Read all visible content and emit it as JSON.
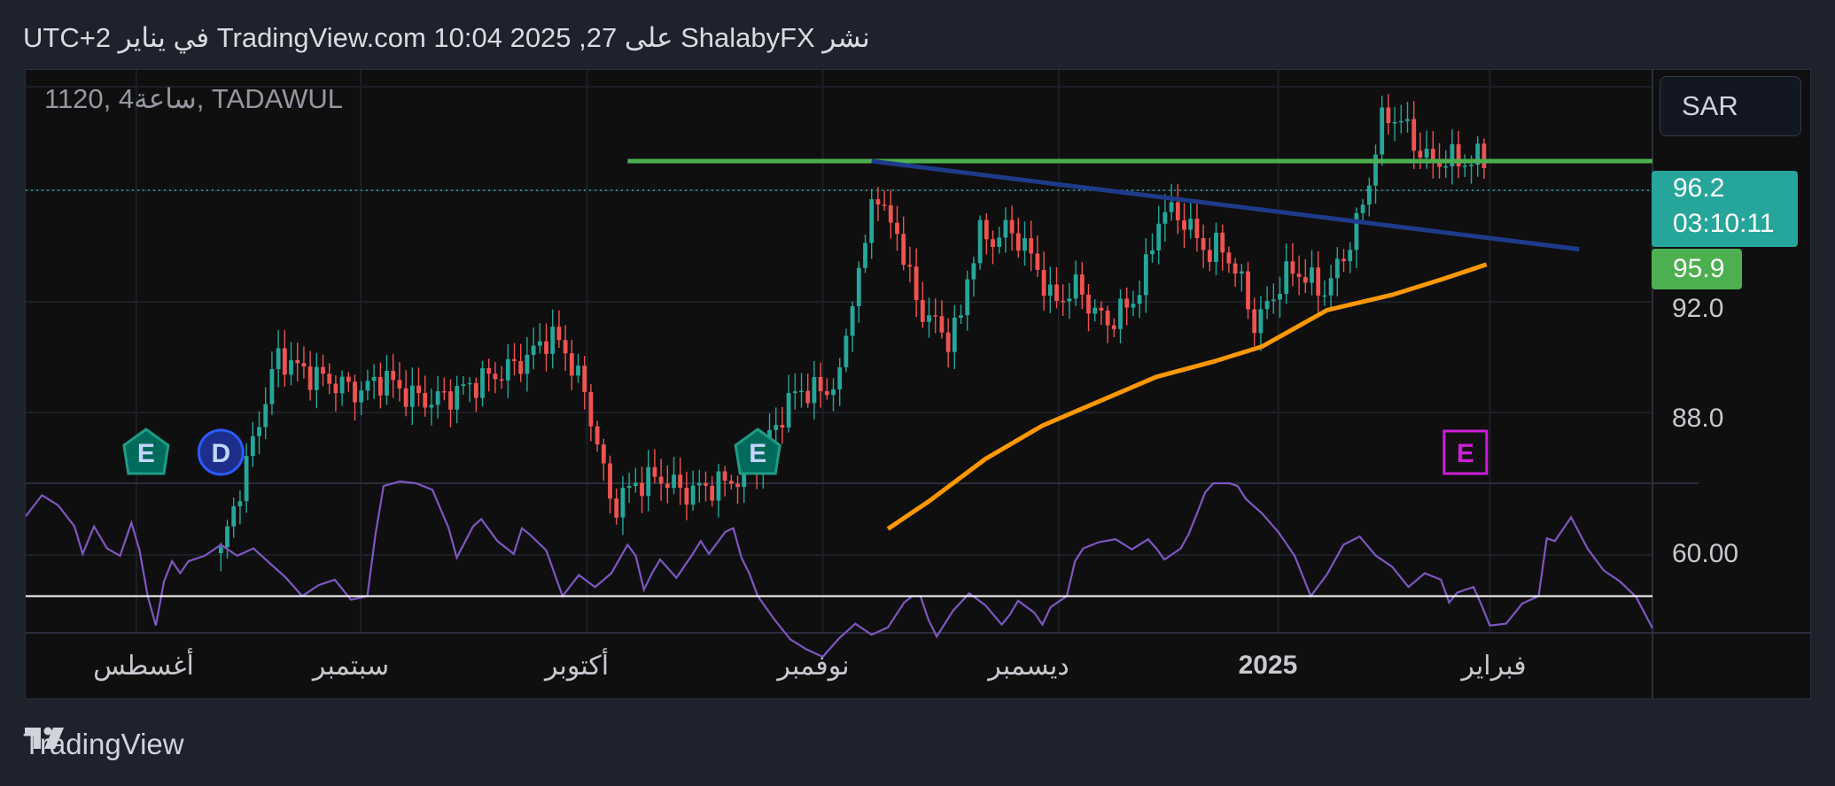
{
  "header": {
    "published": "نشر ShalabyFX على TradingView.com 10:04 2025 ,27 في يناير UTC+2"
  },
  "symbol": {
    "label": "1120, 4ساعة, TADAWUL"
  },
  "currency": "SAR",
  "price_tag": {
    "price": "96.2",
    "countdown": "03:10:11"
  },
  "green_tag": "95.9",
  "price_axis": {
    "labels": [
      "92.0",
      "88.0"
    ]
  },
  "rsi_axis": {
    "labels": [
      "60.00"
    ]
  },
  "time_axis": {
    "labels": [
      "أغسطس",
      "سبتمبر",
      "أكتوبر",
      "نوفمبر",
      "ديسمبر",
      "2025",
      "فبراير"
    ]
  },
  "event_markers": [
    {
      "letter": "E",
      "kind": "earnings"
    },
    {
      "letter": "D",
      "kind": "dividend"
    },
    {
      "letter": "E",
      "kind": "earnings"
    },
    {
      "letter": "E",
      "kind": "earnings-upcoming"
    }
  ],
  "footer": {
    "brand": "TradingView"
  },
  "colors": {
    "up": "#26a69a",
    "down": "#ef5350",
    "resistance": "#4caf50",
    "trendline": "#1e3a8a",
    "moving_average": "#ff9800",
    "rsi": "#7e57c2",
    "rsi_level": "#ffffff",
    "background": "#0f0f0f",
    "frame": "#1e222d"
  },
  "chart_data": [
    {
      "type": "candlestick",
      "title": "1120, 4ساعة, TADAWUL",
      "currency": "SAR",
      "x": [
        "أغسطس",
        "سبتمبر",
        "أكتوبر",
        "نوفمبر",
        "ديسمبر",
        "2025",
        "فبراير"
      ],
      "ylim": [
        85.3,
        98.9
      ],
      "y_ticks": [
        92.0,
        88.0
      ],
      "last_price": 96.2,
      "resistance_level": 95.9,
      "series": [
        {
          "name": "price_close",
          "points": [
            [
              0.12,
              83.0
            ],
            [
              0.155,
              89.5
            ],
            [
              0.17,
              89.0
            ],
            [
              0.19,
              88.6
            ],
            [
              0.205,
              88.3
            ],
            [
              0.22,
              88.8
            ],
            [
              0.235,
              88.2
            ],
            [
              0.25,
              88.0
            ],
            [
              0.265,
              88.3
            ],
            [
              0.28,
              88.7
            ],
            [
              0.295,
              89.0
            ],
            [
              0.31,
              89.5
            ],
            [
              0.322,
              90.2
            ],
            [
              0.33,
              89.8
            ],
            [
              0.338,
              89.0
            ],
            [
              0.345,
              88.0
            ],
            [
              0.352,
              86.5
            ],
            [
              0.36,
              84.5
            ],
            [
              0.375,
              85.3
            ],
            [
              0.39,
              85.5
            ],
            [
              0.405,
              85.0
            ],
            [
              0.42,
              85.2
            ],
            [
              0.435,
              85.4
            ],
            [
              0.45,
              86.0
            ],
            [
              0.465,
              87.6
            ],
            [
              0.475,
              88.4
            ],
            [
              0.487,
              88.3
            ],
            [
              0.5,
              88.6
            ],
            [
              0.508,
              91.5
            ],
            [
              0.515,
              92.6
            ],
            [
              0.522,
              95.5
            ],
            [
              0.527,
              94.0
            ],
            [
              0.535,
              93.8
            ],
            [
              0.542,
              92.2
            ],
            [
              0.55,
              91.0
            ],
            [
              0.56,
              90.5
            ],
            [
              0.568,
              90.0
            ],
            [
              0.575,
              90.8
            ],
            [
              0.58,
              92.5
            ],
            [
              0.587,
              93.5
            ],
            [
              0.595,
              93.3
            ],
            [
              0.605,
              93.7
            ],
            [
              0.615,
              93.0
            ],
            [
              0.622,
              92.4
            ],
            [
              0.63,
              91.3
            ],
            [
              0.64,
              91.5
            ],
            [
              0.648,
              91.8
            ],
            [
              0.655,
              91.0
            ],
            [
              0.665,
              90.6
            ],
            [
              0.675,
              91.0
            ],
            [
              0.682,
              91.4
            ],
            [
              0.69,
              92.5
            ],
            [
              0.697,
              94.2
            ],
            [
              0.705,
              94.2
            ],
            [
              0.712,
              94.0
            ],
            [
              0.72,
              93.3
            ],
            [
              0.728,
              92.9
            ],
            [
              0.735,
              93.1
            ],
            [
              0.742,
              92.5
            ],
            [
              0.75,
              91.5
            ],
            [
              0.755,
              90.5
            ],
            [
              0.762,
              91.0
            ],
            [
              0.77,
              91.8
            ],
            [
              0.778,
              92.3
            ],
            [
              0.785,
              92.2
            ],
            [
              0.79,
              91.9
            ],
            [
              0.797,
              91.6
            ],
            [
              0.803,
              92.0
            ],
            [
              0.81,
              92.8
            ],
            [
              0.817,
              93.6
            ],
            [
              0.825,
              95.0
            ],
            [
              0.832,
              97.0
            ],
            [
              0.838,
              97.4
            ],
            [
              0.845,
              97.3
            ],
            [
              0.852,
              96.6
            ],
            [
              0.858,
              96.2
            ],
            [
              0.865,
              95.8
            ],
            [
              0.872,
              96.0
            ],
            [
              0.88,
              95.9
            ],
            [
              0.888,
              95.9
            ],
            [
              0.895,
              96.0
            ],
            [
              0.9,
              95.9
            ]
          ]
        },
        {
          "name": "resistance",
          "points": [
            [
              0.37,
              95.9
            ],
            [
              1.0,
              95.9
            ]
          ]
        },
        {
          "name": "trendline",
          "points": [
            [
              0.52,
              95.9
            ],
            [
              0.955,
              93.0
            ]
          ]
        },
        {
          "name": "moving_average",
          "points": [
            [
              0.53,
              83.8
            ],
            [
              0.555,
              84.7
            ],
            [
              0.59,
              86.1
            ],
            [
              0.625,
              87.2
            ],
            [
              0.66,
              88.0
            ],
            [
              0.695,
              88.8
            ],
            [
              0.73,
              89.3
            ],
            [
              0.76,
              89.8
            ],
            [
              0.8,
              91.0
            ],
            [
              0.84,
              91.5
            ],
            [
              0.87,
              92.0
            ],
            [
              0.898,
              92.5
            ]
          ]
        }
      ]
    },
    {
      "type": "line",
      "title": "",
      "ylim": [
        50.0,
        66.3
      ],
      "y_ticks": [
        60.0
      ],
      "reference_level": 54.0,
      "series": [
        {
          "name": "",
          "points": [
            [
              0.0,
              62.7
            ],
            [
              0.01,
              65.0
            ],
            [
              0.02,
              63.9
            ],
            [
              0.03,
              61.6
            ],
            [
              0.035,
              58.6
            ],
            [
              0.042,
              61.6
            ],
            [
              0.05,
              59.2
            ],
            [
              0.058,
              58.4
            ],
            [
              0.065,
              62.0
            ],
            [
              0.07,
              59.0
            ],
            [
              0.075,
              54.0
            ],
            [
              0.08,
              50.8
            ],
            [
              0.085,
              55.6
            ],
            [
              0.09,
              57.8
            ],
            [
              0.095,
              56.5
            ],
            [
              0.1,
              57.8
            ],
            [
              0.11,
              58.4
            ],
            [
              0.12,
              59.6
            ],
            [
              0.13,
              58.4
            ],
            [
              0.14,
              59.2
            ],
            [
              0.15,
              57.6
            ],
            [
              0.16,
              56.0
            ],
            [
              0.17,
              54.0
            ],
            [
              0.18,
              55.2
            ],
            [
              0.19,
              55.8
            ],
            [
              0.2,
              53.6
            ],
            [
              0.21,
              54.0
            ],
            [
              0.215,
              60.7
            ],
            [
              0.22,
              66.0
            ],
            [
              0.23,
              66.5
            ],
            [
              0.24,
              66.3
            ],
            [
              0.25,
              65.6
            ],
            [
              0.26,
              61.4
            ],
            [
              0.265,
              58.2
            ],
            [
              0.275,
              61.6
            ],
            [
              0.28,
              62.4
            ],
            [
              0.29,
              60.0
            ],
            [
              0.3,
              58.6
            ],
            [
              0.305,
              61.4
            ],
            [
              0.31,
              60.7
            ],
            [
              0.32,
              59.0
            ],
            [
              0.33,
              54.0
            ],
            [
              0.34,
              56.3
            ],
            [
              0.35,
              55.0
            ],
            [
              0.36,
              56.5
            ],
            [
              0.37,
              59.6
            ],
            [
              0.375,
              58.4
            ],
            [
              0.38,
              54.7
            ],
            [
              0.385,
              56.5
            ],
            [
              0.39,
              58.0
            ],
            [
              0.4,
              56.0
            ],
            [
              0.41,
              58.6
            ],
            [
              0.415,
              60.0
            ],
            [
              0.42,
              58.6
            ],
            [
              0.43,
              61.0
            ],
            [
              0.435,
              61.4
            ],
            [
              0.44,
              58.2
            ],
            [
              0.445,
              56.4
            ],
            [
              0.45,
              54.0
            ],
            [
              0.46,
              51.5
            ],
            [
              0.47,
              49.3
            ],
            [
              0.48,
              48.2
            ],
            [
              0.49,
              47.4
            ],
            [
              0.5,
              49.4
            ],
            [
              0.51,
              51.0
            ],
            [
              0.52,
              49.8
            ],
            [
              0.53,
              50.6
            ],
            [
              0.54,
              53.3
            ],
            [
              0.545,
              54.0
            ],
            [
              0.55,
              54.0
            ],
            [
              0.555,
              51.4
            ],
            [
              0.56,
              49.6
            ],
            [
              0.57,
              52.4
            ],
            [
              0.58,
              54.3
            ],
            [
              0.59,
              53.0
            ],
            [
              0.6,
              50.9
            ],
            [
              0.605,
              52.0
            ],
            [
              0.61,
              53.5
            ],
            [
              0.62,
              52.2
            ],
            [
              0.625,
              50.9
            ],
            [
              0.63,
              52.8
            ],
            [
              0.64,
              54.0
            ],
            [
              0.645,
              57.8
            ],
            [
              0.65,
              59.2
            ],
            [
              0.66,
              59.9
            ],
            [
              0.67,
              60.2
            ],
            [
              0.68,
              59.1
            ],
            [
              0.69,
              60.2
            ],
            [
              0.695,
              59.2
            ],
            [
              0.7,
              58.0
            ],
            [
              0.71,
              59.2
            ],
            [
              0.715,
              60.8
            ],
            [
              0.72,
              63.0
            ],
            [
              0.725,
              65.3
            ],
            [
              0.73,
              66.3
            ],
            [
              0.74,
              66.3
            ],
            [
              0.745,
              66.0
            ],
            [
              0.75,
              64.6
            ],
            [
              0.76,
              63.0
            ],
            [
              0.77,
              61.0
            ],
            [
              0.78,
              58.4
            ],
            [
              0.79,
              54.0
            ],
            [
              0.8,
              56.4
            ],
            [
              0.81,
              59.6
            ],
            [
              0.82,
              60.5
            ],
            [
              0.83,
              58.4
            ],
            [
              0.84,
              57.2
            ],
            [
              0.85,
              55.0
            ],
            [
              0.86,
              56.5
            ],
            [
              0.87,
              55.8
            ],
            [
              0.875,
              53.3
            ],
            [
              0.88,
              54.4
            ],
            [
              0.89,
              55.0
            ],
            [
              0.895,
              53.0
            ],
            [
              0.9,
              50.8
            ],
            [
              0.91,
              51.0
            ],
            [
              0.92,
              53.2
            ],
            [
              0.93,
              54.0
            ],
            [
              0.935,
              60.3
            ],
            [
              0.94,
              60.0
            ],
            [
              0.95,
              62.6
            ],
            [
              0.96,
              59.2
            ],
            [
              0.97,
              56.8
            ],
            [
              0.98,
              55.6
            ],
            [
              0.99,
              53.9
            ],
            [
              1.0,
              50.5
            ]
          ]
        }
      ]
    }
  ]
}
